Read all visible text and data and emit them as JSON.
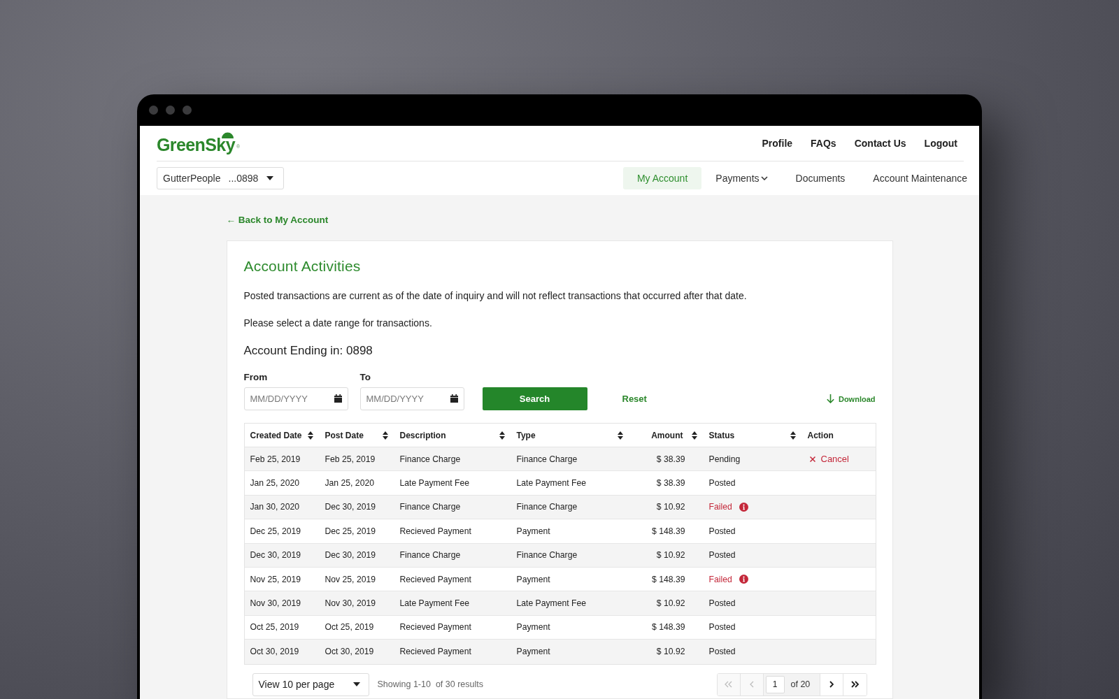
{
  "header": {
    "logo": {
      "text": "GreenSky",
      "mark": "®"
    },
    "links": [
      "Profile",
      "FAQs",
      "Contact Us",
      "Logout"
    ],
    "account_select": {
      "name": "GutterPeople",
      "number": "...0898"
    },
    "nav": [
      {
        "label": "My Account",
        "kind": "link",
        "selected": true
      },
      {
        "label": "Payments",
        "kind": "dropdown",
        "selected": false
      },
      {
        "label": "Documents",
        "kind": "link",
        "selected": false
      },
      {
        "label": "Account Maintenance",
        "kind": "link",
        "selected": false
      }
    ]
  },
  "back_link": "← Back to My Account",
  "card": {
    "title": "Account Activities",
    "notes": [
      "Posted transactions are current as of the date of inquiry and will not reflect transactions that occurred after that date.",
      "Please select a date range for transactions."
    ],
    "account_heading": "Account Ending in: 0898",
    "filters": {
      "fields": [
        {
          "label": "From",
          "placeholder": "MM/DD/YYYY"
        },
        {
          "label": "To",
          "placeholder": "MM/DD/YYYY"
        }
      ],
      "search_button": "Search",
      "reset_button": "Reset",
      "download_link": "Download"
    },
    "table": {
      "columns": [
        {
          "label": "Created Date",
          "kind": "text",
          "sortable": true
        },
        {
          "label": "Post Date",
          "kind": "text",
          "sortable": true
        },
        {
          "label": "Description",
          "kind": "text",
          "sortable": true
        },
        {
          "label": "Type",
          "kind": "text",
          "sortable": true
        },
        {
          "label": "Amount",
          "kind": "amount",
          "sortable": true
        },
        {
          "label": "Status",
          "kind": "status",
          "sortable": true
        },
        {
          "label": "Action",
          "kind": "action",
          "sortable": false
        }
      ],
      "rows": [
        {
          "cells": [
            "Feb 25, 2019",
            "Feb 25, 2019",
            "Finance Charge",
            "Finance Charge",
            "$ 38.39"
          ],
          "status": {
            "label": "Pending",
            "kind": "pending"
          },
          "action": {
            "label": "Cancel",
            "kind": "cancel"
          }
        },
        {
          "cells": [
            "Jan 25, 2020",
            "Jan 25, 2020",
            "Late Payment Fee",
            "Late Payment Fee",
            "$ 38.39"
          ],
          "status": {
            "label": "Posted",
            "kind": "posted"
          }
        },
        {
          "cells": [
            "Jan 30, 2020",
            "Dec 30, 2019",
            "Finance Charge",
            "Finance Charge",
            "$ 10.92"
          ],
          "status": {
            "label": "Failed",
            "kind": "failed"
          }
        },
        {
          "cells": [
            "Dec 25, 2019",
            "Dec 25, 2019",
            "Recieved Payment",
            "Payment",
            "$ 148.39"
          ],
          "status": {
            "label": "Posted",
            "kind": "posted"
          }
        },
        {
          "cells": [
            "Dec 30, 2019",
            "Dec 30, 2019",
            "Finance Charge",
            "Finance Charge",
            "$ 10.92"
          ],
          "status": {
            "label": "Posted",
            "kind": "posted"
          }
        },
        {
          "cells": [
            "Nov 25, 2019",
            "Nov 25, 2019",
            "Recieved Payment",
            "Payment",
            "$ 148.39"
          ],
          "status": {
            "label": "Failed",
            "kind": "failed"
          }
        },
        {
          "cells": [
            "Nov 30, 2019",
            "Nov 30, 2019",
            "Late Payment Fee",
            "Late Payment Fee",
            "$ 10.92"
          ],
          "status": {
            "label": "Posted",
            "kind": "posted"
          }
        },
        {
          "cells": [
            "Oct 25, 2019",
            "Oct 25, 2019",
            "Recieved Payment",
            "Payment",
            "$ 148.39"
          ],
          "status": {
            "label": "Posted",
            "kind": "posted"
          }
        },
        {
          "cells": [
            "Oct 30, 2019",
            "Oct 30, 2019",
            "Recieved Payment",
            "Payment",
            "$ 10.92"
          ],
          "status": {
            "label": "Posted",
            "kind": "posted"
          }
        }
      ]
    },
    "pagination": {
      "per_page": "View 10 per page",
      "summary": "Showing 1-10  of 30 results",
      "page": "1",
      "page_total": "of 20",
      "buttons": [
        {
          "kind": "first",
          "disabled": true
        },
        {
          "kind": "previous",
          "disabled": true
        },
        {
          "kind": "next",
          "disabled": false
        },
        {
          "kind": "last",
          "disabled": false
        }
      ]
    }
  }
}
